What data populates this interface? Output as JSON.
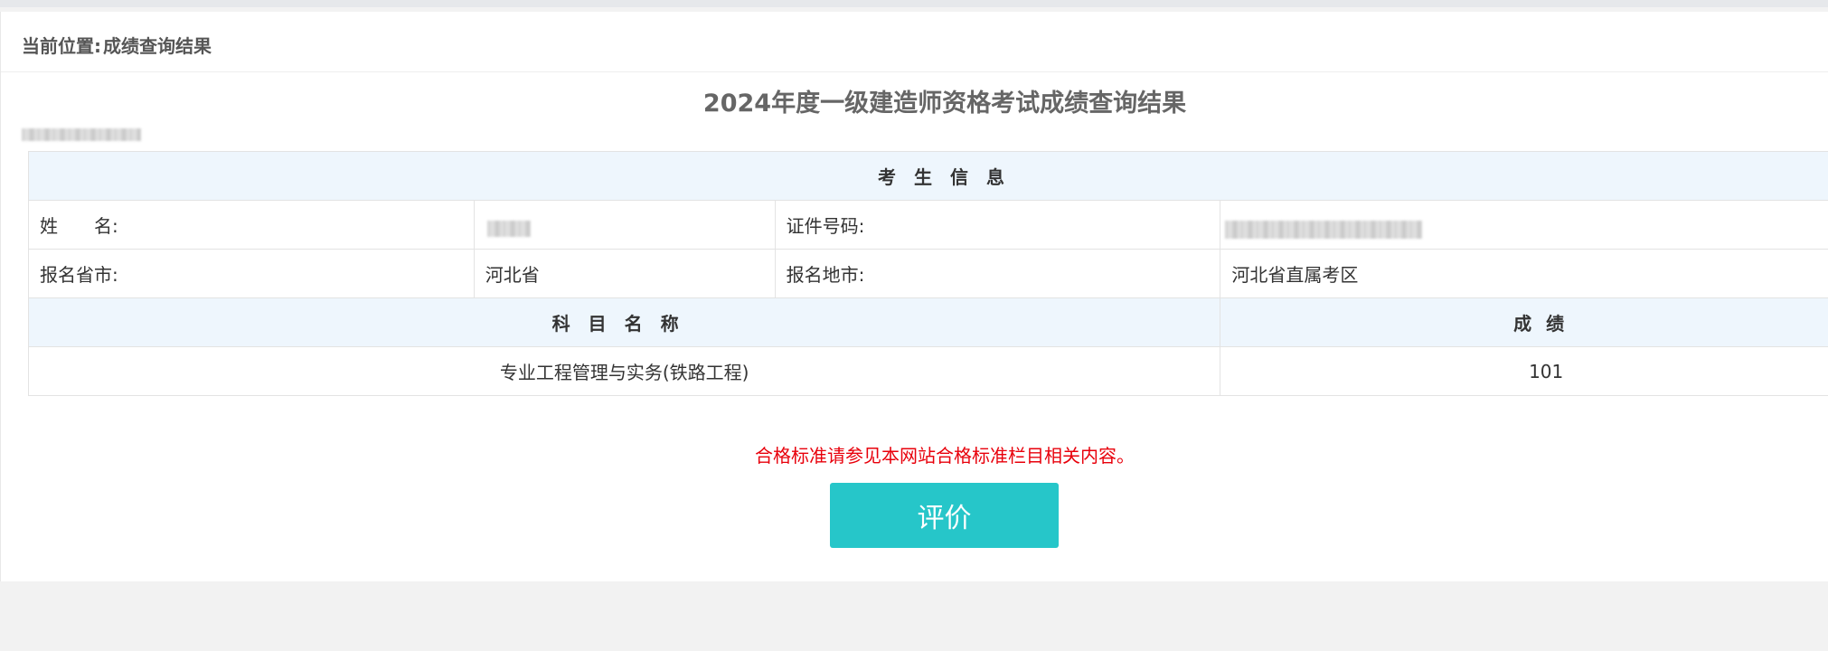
{
  "breadcrumb": {
    "label": "当前位置:",
    "current": "成绩查询结果"
  },
  "title": "2024年度一级建造师资格考试成绩查询结果",
  "candidate_section": {
    "header": "考生信息",
    "name_label": "姓　　名:",
    "id_label": "证件号码:",
    "province_label": "报名省市:",
    "province_value": "河北省",
    "city_label": "报名地市:",
    "city_value": "河北省直属考区"
  },
  "scores_section": {
    "subject_header": "科目名称",
    "score_header": "成绩",
    "rows": [
      {
        "subject": "专业工程管理与实务(铁路工程)",
        "score": "101"
      }
    ]
  },
  "notice": "合格标准请参见本网站合格标准栏目相关内容。",
  "evaluate_button": "评价",
  "colors": {
    "accent": "#26c6c9",
    "notice": "#e8000b",
    "section_bg": "#eef6fd"
  }
}
